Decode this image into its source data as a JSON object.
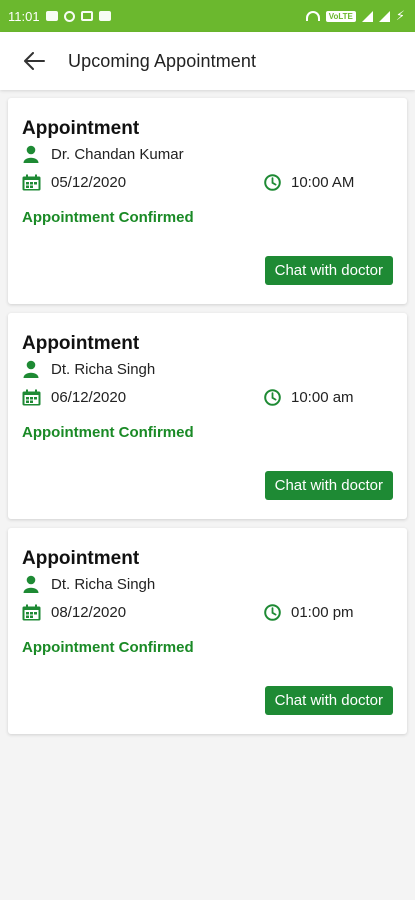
{
  "status_bar": {
    "time": "11:01",
    "network": "VoLTE"
  },
  "header": {
    "title": "Upcoming Appointment"
  },
  "appointments": [
    {
      "title": "Appointment",
      "doctor": "Dr. Chandan Kumar",
      "date": "05/12/2020",
      "time": "10:00 AM",
      "status": "Appointment Confirmed",
      "action": "Chat with doctor"
    },
    {
      "title": "Appointment",
      "doctor": "Dt. Richa Singh",
      "date": "06/12/2020",
      "time": "10:00 am",
      "status": "Appointment Confirmed",
      "action": "Chat with doctor"
    },
    {
      "title": "Appointment",
      "doctor": "Dt. Richa Singh",
      "date": "08/12/2020",
      "time": "01:00 pm",
      "status": "Appointment Confirmed",
      "action": "Chat with doctor"
    }
  ],
  "colors": {
    "status_bar": "#6bb82e",
    "accent": "#1e8a34",
    "confirmed": "#1a8a26"
  }
}
